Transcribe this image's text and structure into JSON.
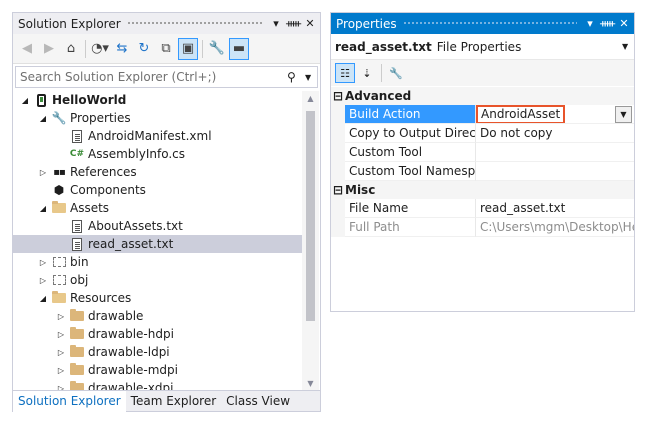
{
  "solution_explorer": {
    "title": "Solution Explorer",
    "title_buttons": [
      "▾",
      "📌",
      "✕"
    ],
    "search_placeholder": "Search Solution Explorer (Ctrl+;)",
    "tree": [
      {
        "label": "HelloWorld",
        "icon": "project-icon",
        "bold": true,
        "expanded": true
      },
      {
        "label": "Properties",
        "icon": "wrench-icon",
        "expanded": true
      },
      {
        "label": "AndroidManifest.xml",
        "icon": "file-icon"
      },
      {
        "label": "AssemblyInfo.cs",
        "icon": "csharp-file-icon"
      },
      {
        "label": "References",
        "icon": "references-icon",
        "expanded": false
      },
      {
        "label": "Components",
        "icon": "components-icon"
      },
      {
        "label": "Assets",
        "icon": "folder-open-icon",
        "expanded": true
      },
      {
        "label": "AboutAssets.txt",
        "icon": "file-icon"
      },
      {
        "label": "read_asset.txt",
        "icon": "file-icon",
        "selected": true
      },
      {
        "label": "bin",
        "icon": "dashed-folder-icon",
        "expanded": false
      },
      {
        "label": "obj",
        "icon": "dashed-folder-icon",
        "expanded": false
      },
      {
        "label": "Resources",
        "icon": "folder-open-icon",
        "expanded": true
      },
      {
        "label": "drawable",
        "icon": "folder-icon",
        "expanded": false
      },
      {
        "label": "drawable-hdpi",
        "icon": "folder-icon",
        "expanded": false
      },
      {
        "label": "drawable-ldpi",
        "icon": "folder-icon",
        "expanded": false
      },
      {
        "label": "drawable-mdpi",
        "icon": "folder-icon",
        "expanded": false
      },
      {
        "label": "drawable-xdpi",
        "icon": "folder-icon",
        "expanded": false
      }
    ],
    "tabs": [
      "Solution Explorer",
      "Team Explorer",
      "Class View"
    ]
  },
  "properties": {
    "title": "Properties",
    "title_buttons": [
      "▾",
      "📌",
      "✕"
    ],
    "object_name": "read_asset.txt",
    "object_type": "File Properties",
    "categories": [
      {
        "name": "Advanced",
        "rows": [
          {
            "name": "Build Action",
            "value": "AndroidAsset",
            "selected": true,
            "highlighted": true,
            "has_dropdown": true
          },
          {
            "name": "Copy to Output Director",
            "value": "Do not copy"
          },
          {
            "name": "Custom Tool",
            "value": ""
          },
          {
            "name": "Custom Tool Namespac",
            "value": ""
          }
        ]
      },
      {
        "name": "Misc",
        "rows": [
          {
            "name": "File Name",
            "value": "read_asset.txt"
          },
          {
            "name": "Full Path",
            "value": "C:\\Users\\mgm\\Desktop\\Hell",
            "disabled": true
          }
        ]
      }
    ]
  },
  "colors": {
    "accent": "#007acc",
    "selection": "#3399ff",
    "highlight_border": "#e8542b",
    "tree_selected": "#cccedb"
  }
}
